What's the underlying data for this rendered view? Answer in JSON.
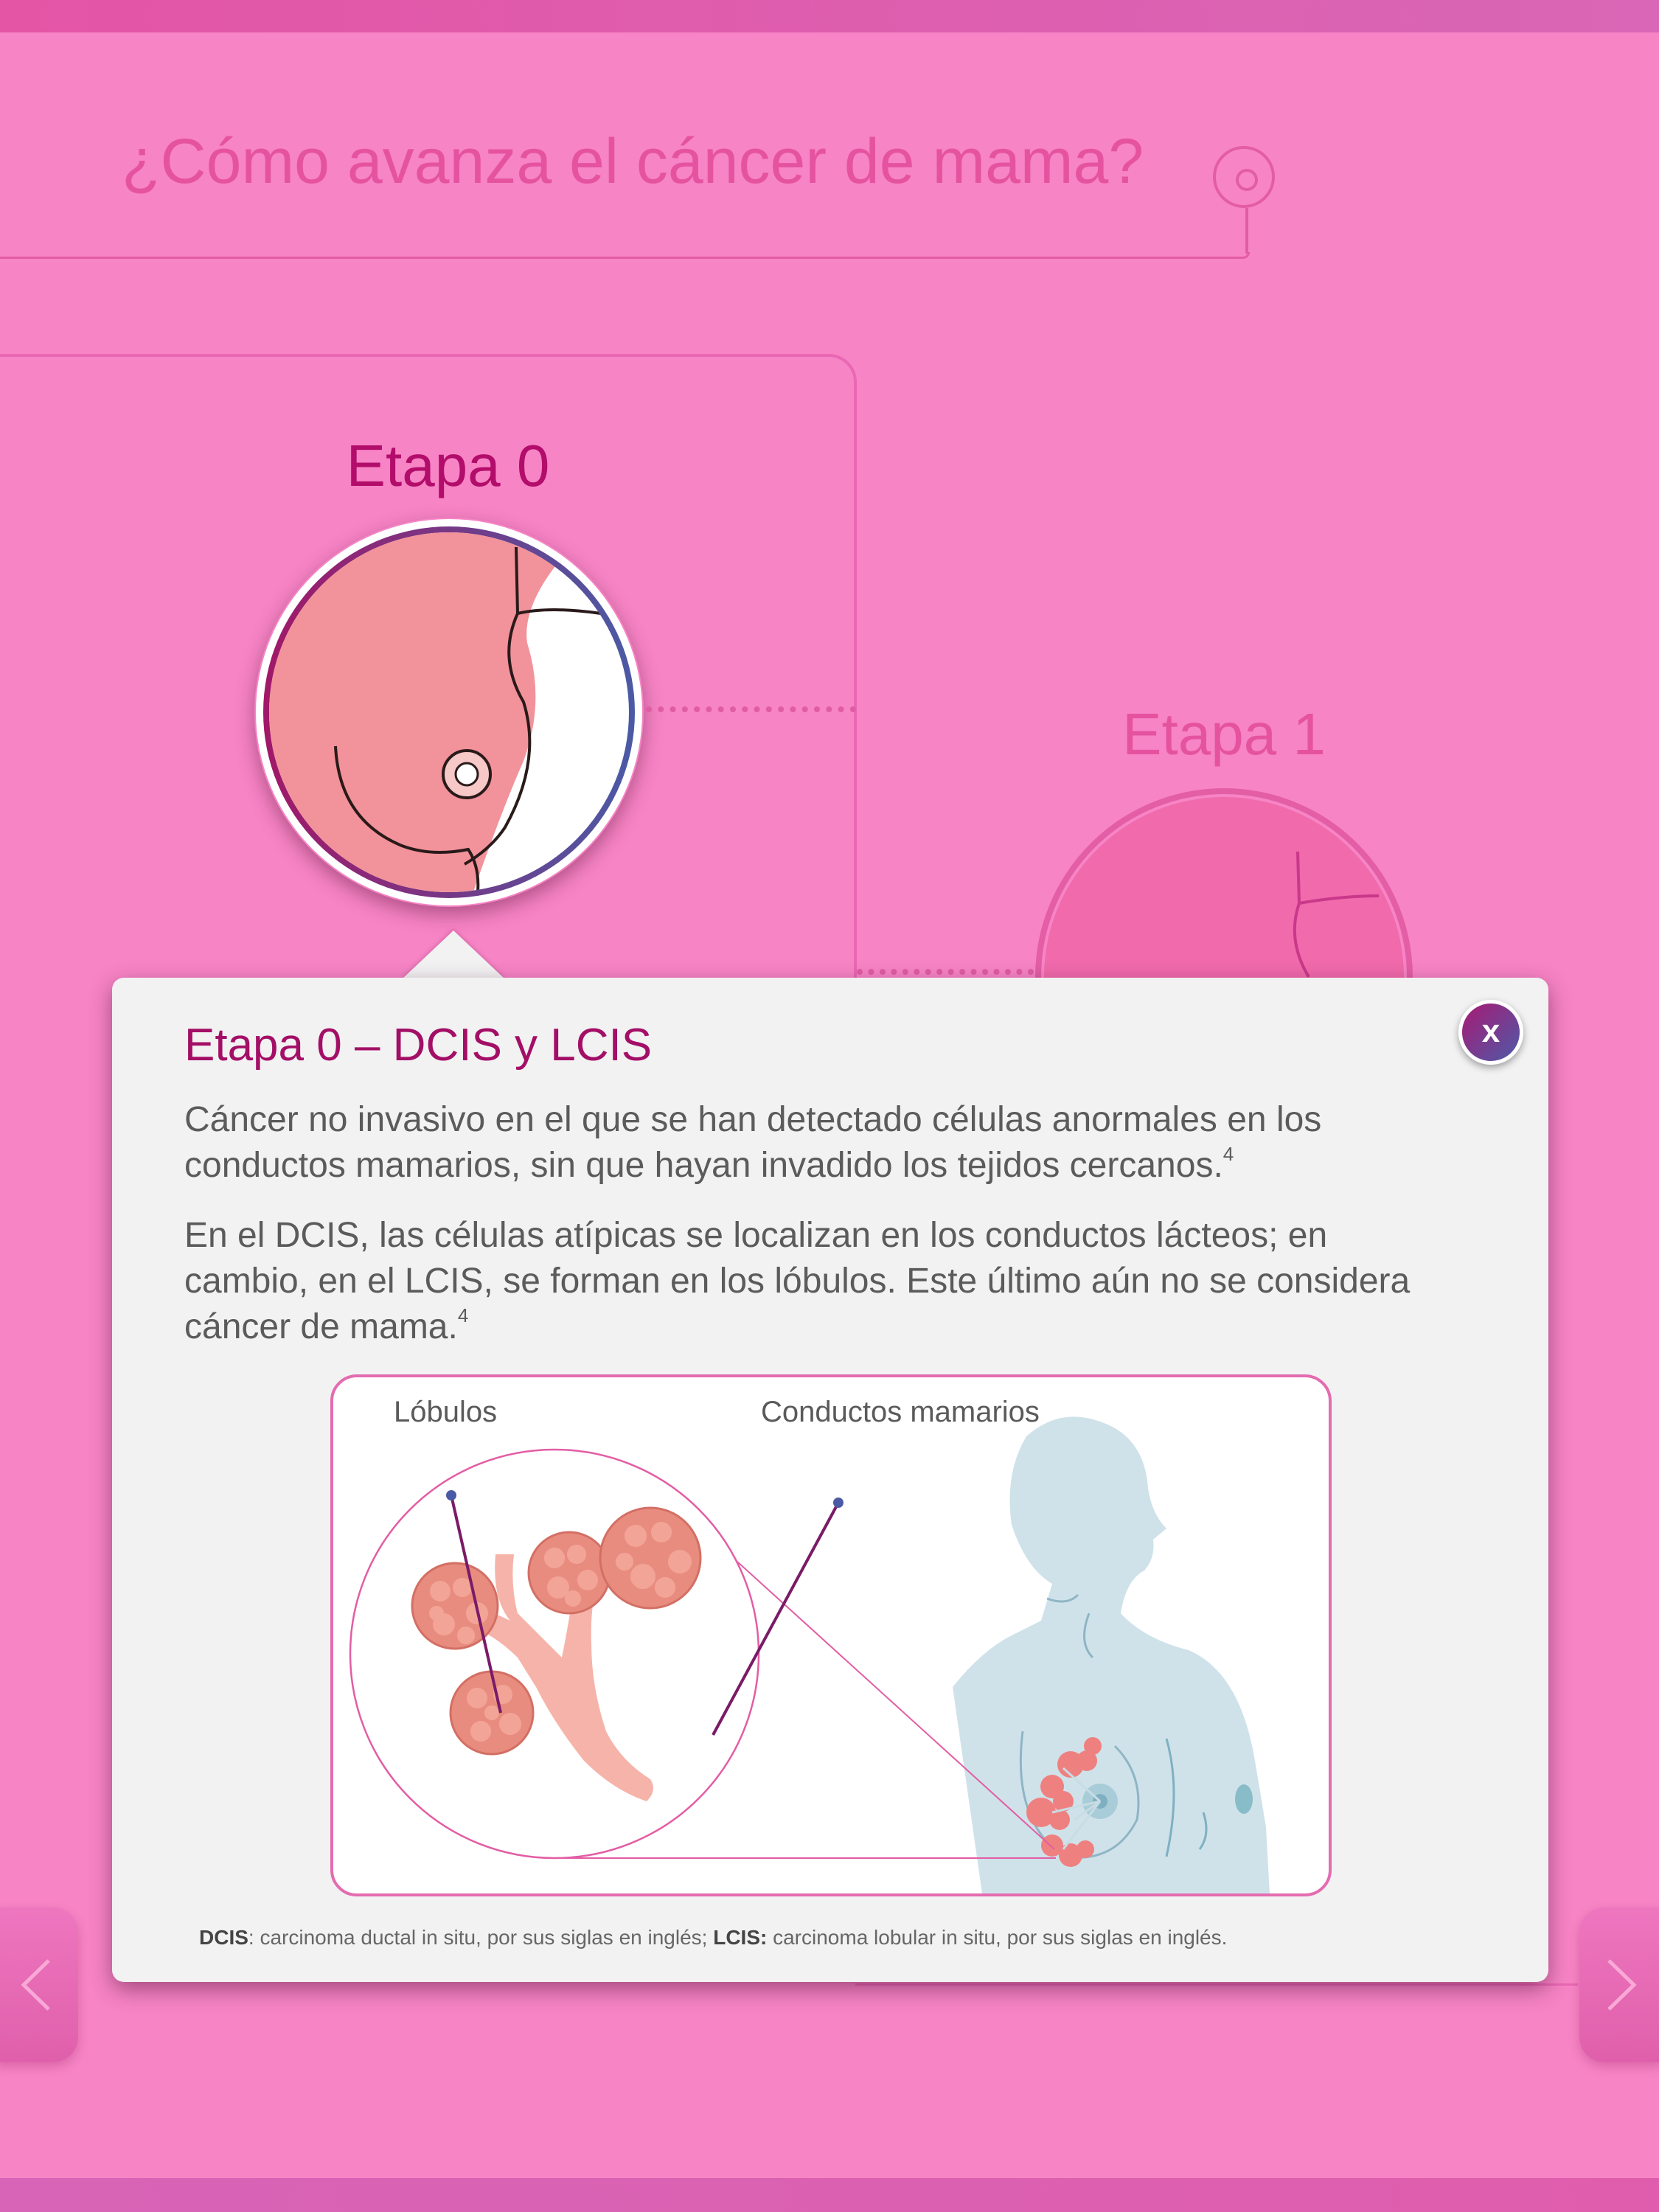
{
  "page": {
    "title": "¿Cómo avanza el cáncer de mama?"
  },
  "stages": [
    {
      "label": "Etapa 0"
    },
    {
      "label": "Etapa 1"
    }
  ],
  "popup": {
    "title": "Etapa 0 – DCIS y LCIS",
    "close_label": "x",
    "paragraph1": "Cáncer no invasivo en el que se han detectado células anormales en los conductos mamarios, sin que hayan invadido los tejidos cercanos.",
    "paragraph1_ref": "4",
    "paragraph2": "En el DCIS, las células atípicas se localizan en los conductos lácteos; en cambio, en el LCIS, se forman en los lóbulos. Este último aún no se considera cáncer de mama.",
    "paragraph2_ref": "4",
    "figure": {
      "label_lobules": "Lóbulos",
      "label_ducts": "Conductos mamarios"
    },
    "footnote": {
      "dcis_abbr": "DCIS",
      "dcis_text": ": carcinoma ductal in situ, por sus siglas en inglés; ",
      "lcis_abbr": "LCIS:",
      "lcis_text": " carcinoma lobular in situ, por sus siglas en inglés."
    }
  },
  "colors": {
    "background": "#f784c5",
    "title_pink": "#e5539f",
    "stage_active": "#b20d6b",
    "popup_title": "#a30f66",
    "popup_bg": "#f2f2f2"
  },
  "icons": {
    "close": "close-icon",
    "prev": "chevron-left-icon",
    "next": "chevron-right-icon"
  }
}
